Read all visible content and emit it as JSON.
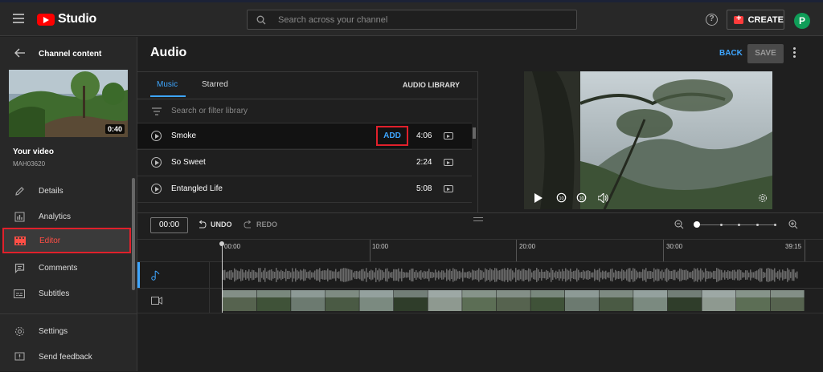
{
  "header": {
    "logo_text": "Studio",
    "search_placeholder": "Search across your channel",
    "help_glyph": "?",
    "create_label": "CREATE",
    "avatar_letter": "P"
  },
  "sidebar": {
    "section_title": "Channel content",
    "thumb_duration": "0:40",
    "your_video_label": "Your video",
    "video_id": "MAH03620",
    "items": [
      {
        "label": "Details",
        "icon": "pencil-icon"
      },
      {
        "label": "Analytics",
        "icon": "analytics-icon"
      },
      {
        "label": "Editor",
        "icon": "editor-icon",
        "active": true
      },
      {
        "label": "Comments",
        "icon": "comments-icon"
      },
      {
        "label": "Subtitles",
        "icon": "subtitles-icon"
      }
    ],
    "bottom_items": [
      {
        "label": "Settings",
        "icon": "gear-icon"
      },
      {
        "label": "Send feedback",
        "icon": "feedback-icon"
      }
    ]
  },
  "main": {
    "title": "Audio",
    "back_label": "BACK",
    "save_label": "SAVE"
  },
  "audio_panel": {
    "tabs": [
      {
        "label": "Music",
        "active": true
      },
      {
        "label": "Starred",
        "active": false
      }
    ],
    "library_label": "AUDIO LIBRARY",
    "filter_placeholder": "Search or filter library",
    "tracks": [
      {
        "name": "Smoke",
        "duration": "4:06",
        "add_label": "ADD",
        "selected": true
      },
      {
        "name": "So Sweet",
        "duration": "2:24"
      },
      {
        "name": "Entangled Life",
        "duration": "5:08"
      }
    ]
  },
  "timeline": {
    "timecode": "00:00",
    "undo_label": "UNDO",
    "redo_label": "REDO",
    "ruler_labels": [
      "00:00",
      "10:00",
      "20:00",
      "30:00",
      "39:15"
    ]
  },
  "colors": {
    "accent_blue": "#3ea6ff",
    "highlight_red": "#e0202b",
    "brand_red": "#ff0000",
    "avatar_green": "#0f9d58"
  }
}
